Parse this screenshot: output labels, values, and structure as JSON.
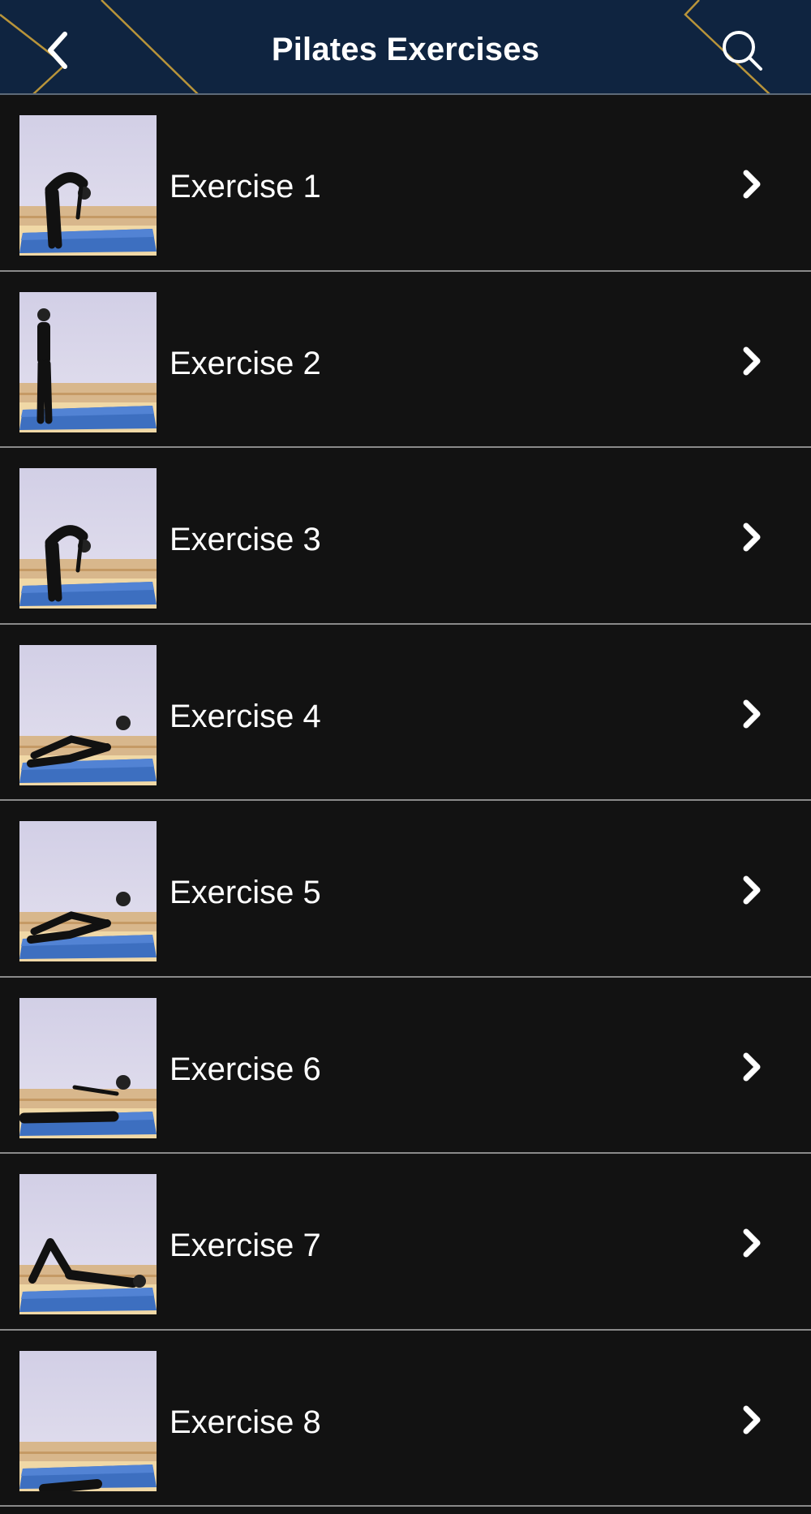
{
  "header": {
    "title": "Pilates Exercises",
    "back_icon": "chevron-left-icon",
    "search_icon": "search-icon",
    "background": "#0f2440",
    "accent": "#b8943a"
  },
  "exercises": [
    {
      "label": "Exercise 1",
      "pose": "forward-bend"
    },
    {
      "label": "Exercise 2",
      "pose": "standing"
    },
    {
      "label": "Exercise 3",
      "pose": "forward-bend"
    },
    {
      "label": "Exercise 4",
      "pose": "roll-up-seated"
    },
    {
      "label": "Exercise 5",
      "pose": "roll-up-seated"
    },
    {
      "label": "Exercise 6",
      "pose": "lying-arms-forward"
    },
    {
      "label": "Exercise 7",
      "pose": "lying-knees-up"
    },
    {
      "label": "Exercise 8",
      "pose": "lying"
    }
  ]
}
